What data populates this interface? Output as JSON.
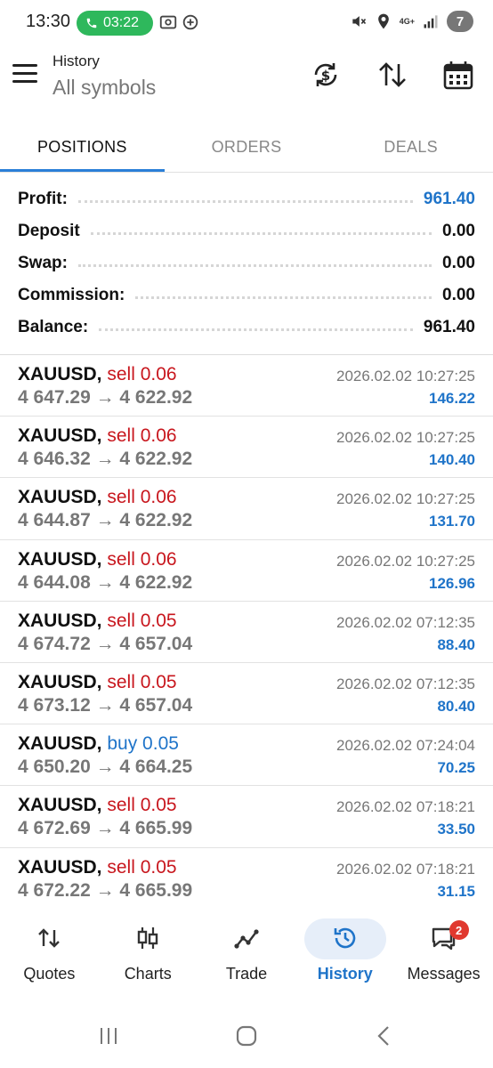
{
  "status_bar": {
    "time": "13:30",
    "call_timer": "03:22",
    "battery": "7",
    "network": "4G+"
  },
  "app_bar": {
    "title": "History",
    "subtitle": "All symbols",
    "icons": [
      "menu-icon",
      "currency-exchange-icon",
      "sort-icon",
      "calendar-icon"
    ]
  },
  "tabs": [
    {
      "label": "POSITIONS",
      "active": true
    },
    {
      "label": "ORDERS",
      "active": false
    },
    {
      "label": "DEALS",
      "active": false
    }
  ],
  "summary": {
    "profit": {
      "label": "Profit:",
      "value": "961.40"
    },
    "deposit": {
      "label": "Deposit",
      "value": "0.00"
    },
    "swap": {
      "label": "Swap:",
      "value": "0.00"
    },
    "commission": {
      "label": "Commission:",
      "value": "0.00"
    },
    "balance": {
      "label": "Balance:",
      "value": "961.40"
    }
  },
  "positions": [
    {
      "symbol": "XAUUSD,",
      "side": "sell 0.06",
      "type": "sell",
      "open": "4 647.29",
      "close": "4 622.92",
      "time": "2026.02.02 10:27:25",
      "profit": "146.22"
    },
    {
      "symbol": "XAUUSD,",
      "side": "sell 0.06",
      "type": "sell",
      "open": "4 646.32",
      "close": "4 622.92",
      "time": "2026.02.02 10:27:25",
      "profit": "140.40"
    },
    {
      "symbol": "XAUUSD,",
      "side": "sell 0.06",
      "type": "sell",
      "open": "4 644.87",
      "close": "4 622.92",
      "time": "2026.02.02 10:27:25",
      "profit": "131.70"
    },
    {
      "symbol": "XAUUSD,",
      "side": "sell 0.06",
      "type": "sell",
      "open": "4 644.08",
      "close": "4 622.92",
      "time": "2026.02.02 10:27:25",
      "profit": "126.96"
    },
    {
      "symbol": "XAUUSD,",
      "side": "sell 0.05",
      "type": "sell",
      "open": "4 674.72",
      "close": "4 657.04",
      "time": "2026.02.02 07:12:35",
      "profit": "88.40"
    },
    {
      "symbol": "XAUUSD,",
      "side": "sell 0.05",
      "type": "sell",
      "open": "4 673.12",
      "close": "4 657.04",
      "time": "2026.02.02 07:12:35",
      "profit": "80.40"
    },
    {
      "symbol": "XAUUSD,",
      "side": "buy 0.05",
      "type": "buy",
      "open": "4 650.20",
      "close": "4 664.25",
      "time": "2026.02.02 07:24:04",
      "profit": "70.25"
    },
    {
      "symbol": "XAUUSD,",
      "side": "sell 0.05",
      "type": "sell",
      "open": "4 672.69",
      "close": "4 665.99",
      "time": "2026.02.02 07:18:21",
      "profit": "33.50"
    },
    {
      "symbol": "XAUUSD,",
      "side": "sell 0.05",
      "type": "sell",
      "open": "4 672.22",
      "close": "4 665.99",
      "time": "2026.02.02 07:18:21",
      "profit": "31.15"
    }
  ],
  "bottom_nav": [
    {
      "label": "Quotes",
      "icon": "quotes-icon",
      "active": false
    },
    {
      "label": "Charts",
      "icon": "charts-icon",
      "active": false
    },
    {
      "label": "Trade",
      "icon": "trade-icon",
      "active": false
    },
    {
      "label": "History",
      "icon": "history-icon",
      "active": true
    },
    {
      "label": "Messages",
      "icon": "messages-icon",
      "active": false,
      "badge": "2"
    }
  ],
  "colors": {
    "accent": "#1f74c9",
    "sell": "#c8161d",
    "call_pill": "#2eb85c",
    "badge": "#e0392f"
  }
}
